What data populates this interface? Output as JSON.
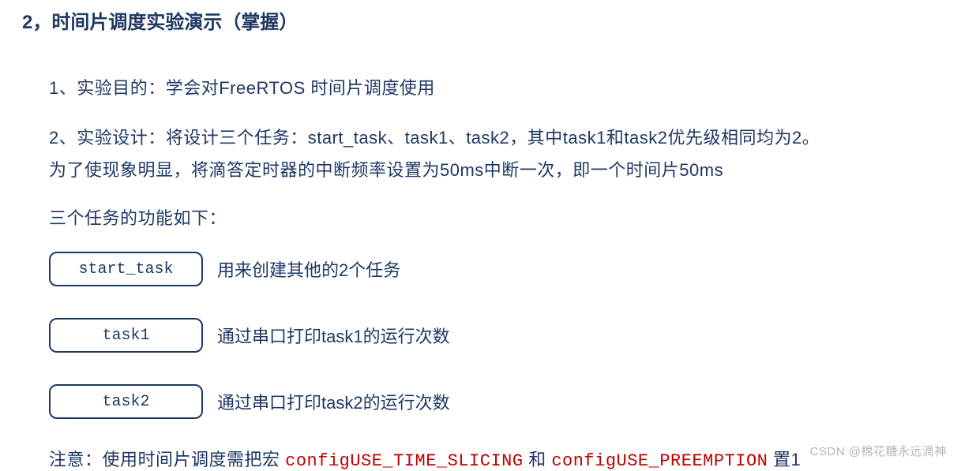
{
  "heading": "2，时间片调度实验演示（掌握）",
  "paragraphs": {
    "p1": "1、实验目的：学会对FreeRTOS 时间片调度使用",
    "p2": "2、实验设计：将设计三个任务：start_task、task1、task2，其中task1和task2优先级相同均为2。",
    "p3": "为了使现象明显，将滴答定时器的中断频率设置为50ms中断一次，即一个时间片50ms",
    "func_intro": "三个任务的功能如下："
  },
  "tasks": [
    {
      "name": "start_task",
      "desc": "用来创建其他的2个任务"
    },
    {
      "name": "task1",
      "desc": "通过串口打印task1的运行次数"
    },
    {
      "name": "task2",
      "desc": "通过串口打印task2的运行次数"
    }
  ],
  "note": {
    "prefix": "注意：使用时间片调度需把宏 ",
    "macro1": "configUSE_TIME_SLICING",
    "and": " 和 ",
    "macro2": "configUSE_PREEMPTION",
    "suffix": " 置1"
  },
  "watermark": "CSDN @棉花糖永远滴神"
}
